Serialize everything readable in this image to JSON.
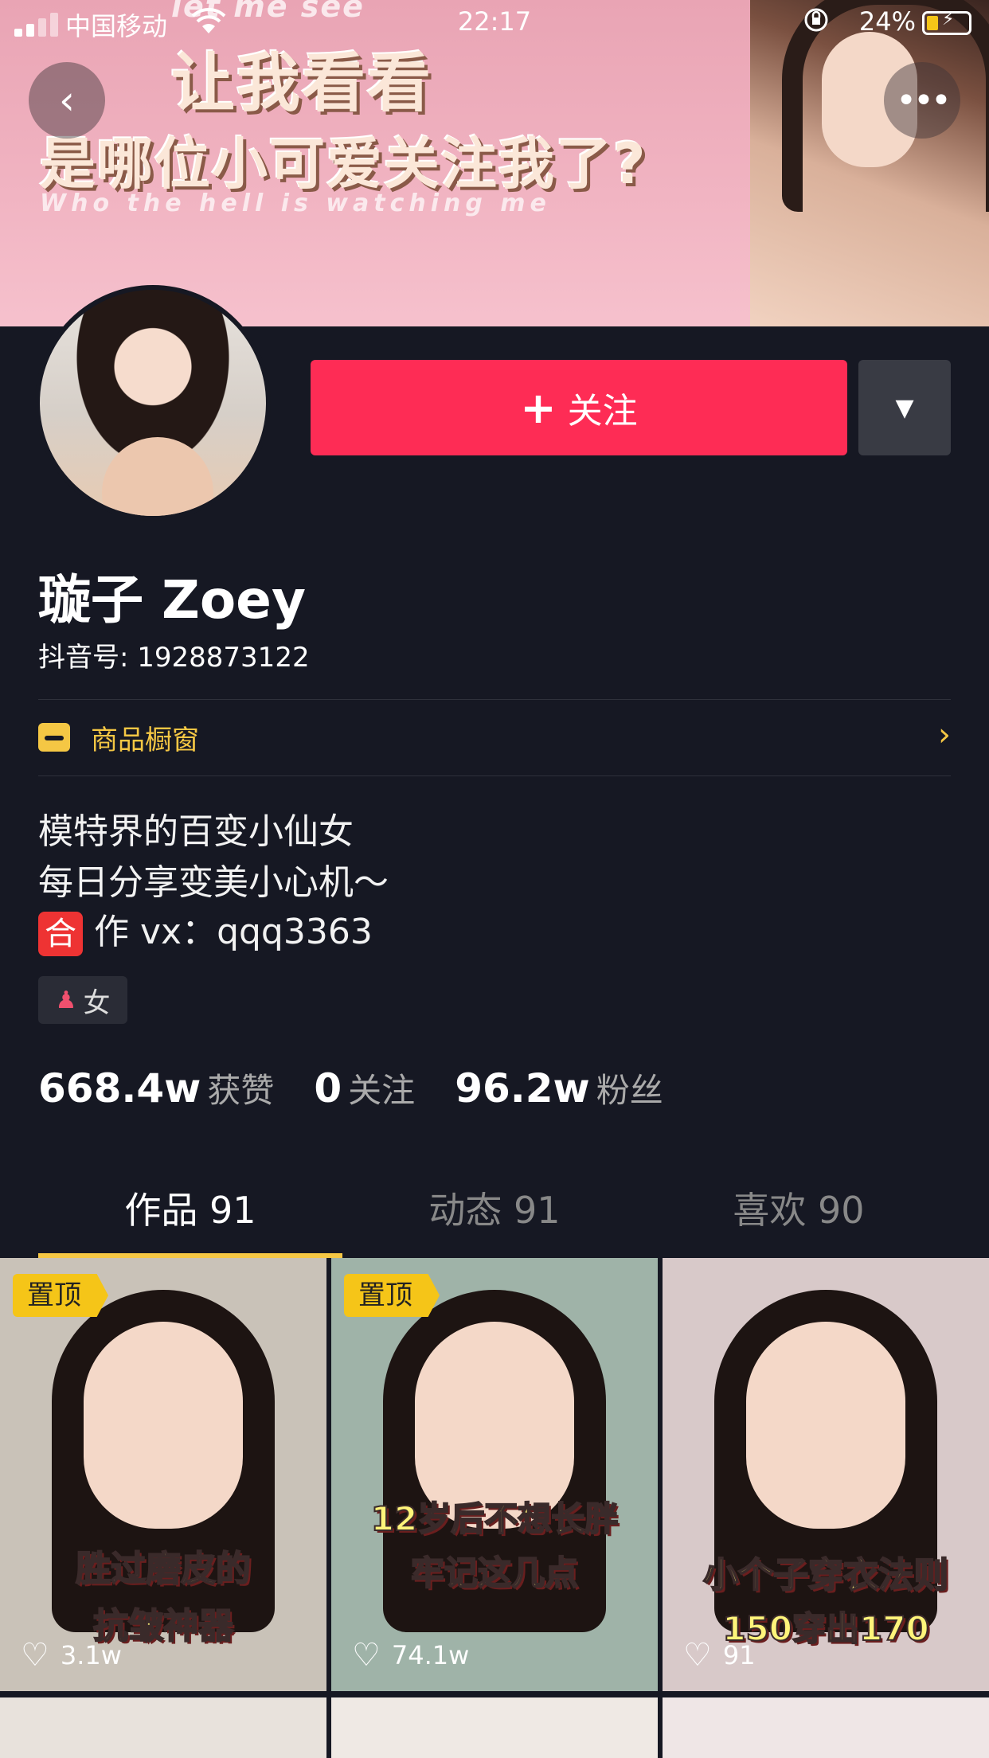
{
  "status_bar": {
    "carrier": "中国移动",
    "time": "22:17",
    "battery": "24%"
  },
  "banner": {
    "line_top": "let me see",
    "line1": "让我看看",
    "line2": "是哪位小可爱关注我了?",
    "line3": "Who the hell is watching me"
  },
  "header": {
    "back_icon": "‹",
    "more_icon": "•••"
  },
  "actions": {
    "follow_plus": "+",
    "follow_label": "关注",
    "dropdown_icon": "▼"
  },
  "profile": {
    "name": "璇子 Zoey",
    "douyin_id": "抖音号: 1928873122",
    "shop_label": "商品橱窗",
    "shop_chevron": "›",
    "bio_line1": "模特界的百变小仙女",
    "bio_line2": "每日分享变美小心机～",
    "bio_line3_badge": "合",
    "bio_line3_text": "作 vx：qqq3363",
    "gender_icon": "♟",
    "gender": "女"
  },
  "stats": [
    {
      "num": "668.4w",
      "label": "获赞"
    },
    {
      "num": "0",
      "label": "关注"
    },
    {
      "num": "96.2w",
      "label": "粉丝"
    }
  ],
  "tabs": [
    {
      "label": "作品 91",
      "active": true
    },
    {
      "label": "动态 91",
      "active": false
    },
    {
      "label": "喜欢 90",
      "active": false
    }
  ],
  "videos": [
    {
      "pinned": "置顶",
      "caption1": "胜过磨皮的",
      "caption2": "抗皱神器",
      "likes": "3.1w",
      "bg": "#c9c2b8"
    },
    {
      "pinned": "置顶",
      "caption1": "12岁后不想长胖",
      "caption2": "牢记这几点",
      "likes": "74.1w",
      "bg": "#9fb3a8"
    },
    {
      "pinned": "",
      "caption1": "小个子穿衣法则",
      "caption2": "150穿出170",
      "likes": "91",
      "bg": "#d8c9c9"
    }
  ]
}
